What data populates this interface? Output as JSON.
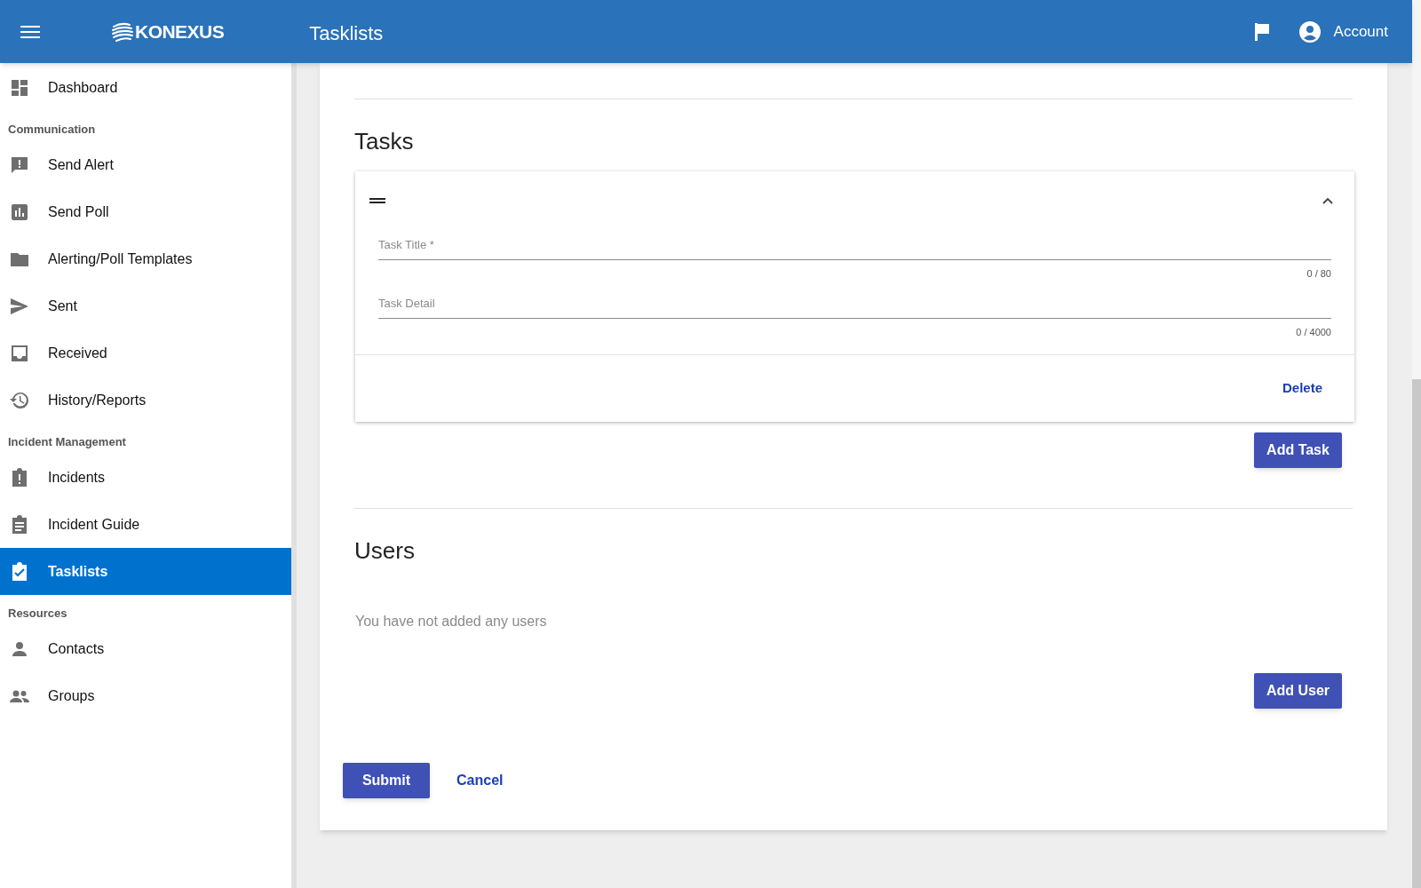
{
  "app_bar": {
    "logo_text": "KONEXUS",
    "title": "Tasklists",
    "account_label": "Account"
  },
  "sidebar": {
    "items": [
      {
        "kind": "item",
        "label": "Dashboard",
        "selected": false
      },
      {
        "kind": "header",
        "label": "Communication"
      },
      {
        "kind": "item",
        "label": "Send Alert",
        "selected": false
      },
      {
        "kind": "item",
        "label": "Send Poll",
        "selected": false
      },
      {
        "kind": "item",
        "label": "Alerting/Poll Templates",
        "selected": false
      },
      {
        "kind": "item",
        "label": "Sent",
        "selected": false
      },
      {
        "kind": "item",
        "label": "Received",
        "selected": false
      },
      {
        "kind": "item",
        "label": "History/Reports",
        "selected": false
      },
      {
        "kind": "header",
        "label": "Incident Management"
      },
      {
        "kind": "item",
        "label": "Incidents",
        "selected": false
      },
      {
        "kind": "item",
        "label": "Incident Guide",
        "selected": false
      },
      {
        "kind": "item",
        "label": "Tasklists",
        "selected": true
      },
      {
        "kind": "header",
        "label": "Resources"
      },
      {
        "kind": "item",
        "label": "Contacts",
        "selected": false
      },
      {
        "kind": "item",
        "label": "Groups",
        "selected": false
      }
    ]
  },
  "tasks": {
    "heading": "Tasks",
    "items": [
      {
        "expanded": true,
        "fields": [
          {
            "placeholder": "Task Title *",
            "counter": "0 / 80"
          },
          {
            "placeholder": "Task Detail",
            "counter": "0 / 4000"
          }
        ],
        "delete_label": "Delete"
      }
    ],
    "add_label": "Add Task"
  },
  "users": {
    "heading": "Users",
    "empty_text": "You have not added any users",
    "add_label": "Add User"
  },
  "actions": {
    "submit_label": "Submit",
    "cancel_label": "Cancel"
  }
}
